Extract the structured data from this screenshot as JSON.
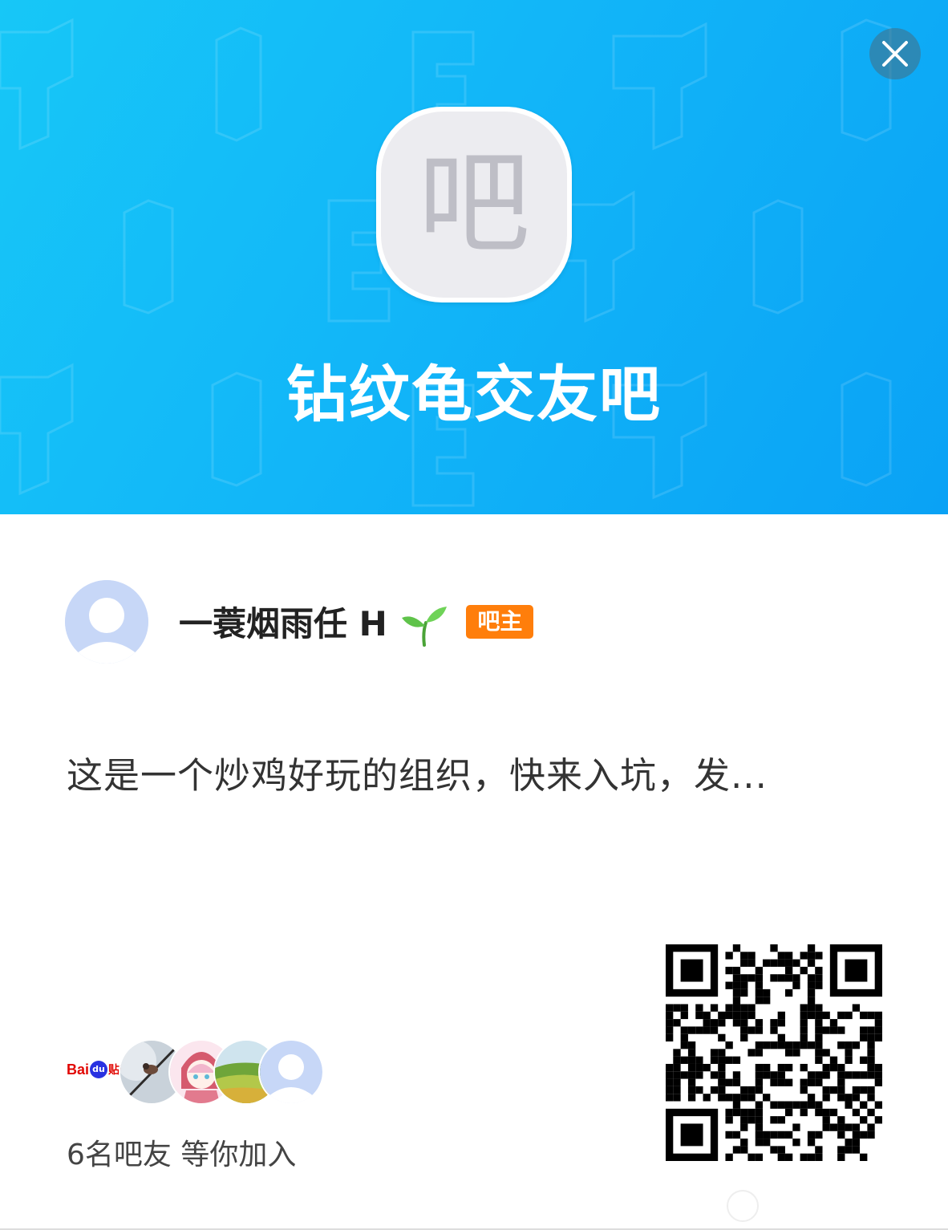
{
  "header": {
    "forum_icon_glyph": "吧",
    "forum_name": "钻纹龟交友吧",
    "close_icon": "close-icon",
    "gradient_colors": [
      "#17c7f7",
      "#0aa2f5"
    ]
  },
  "owner": {
    "name": "一蓑烟雨任 H",
    "name_emoji": "sprout-icon",
    "badge": "吧主",
    "badge_color": "#ff7e0b"
  },
  "description": "这是一个炒鸡好玩的组织，快来入坑，发...",
  "members": {
    "logo": {
      "bai": "Bai",
      "du": "du",
      "tieba": "贴吧"
    },
    "avatars": [
      "bird-on-branch-avatar",
      "anime-girl-avatar",
      "green-field-avatar",
      "default-avatar"
    ],
    "count_text": "6名吧友 等你加入"
  },
  "qr_code": "qr-code-icon"
}
